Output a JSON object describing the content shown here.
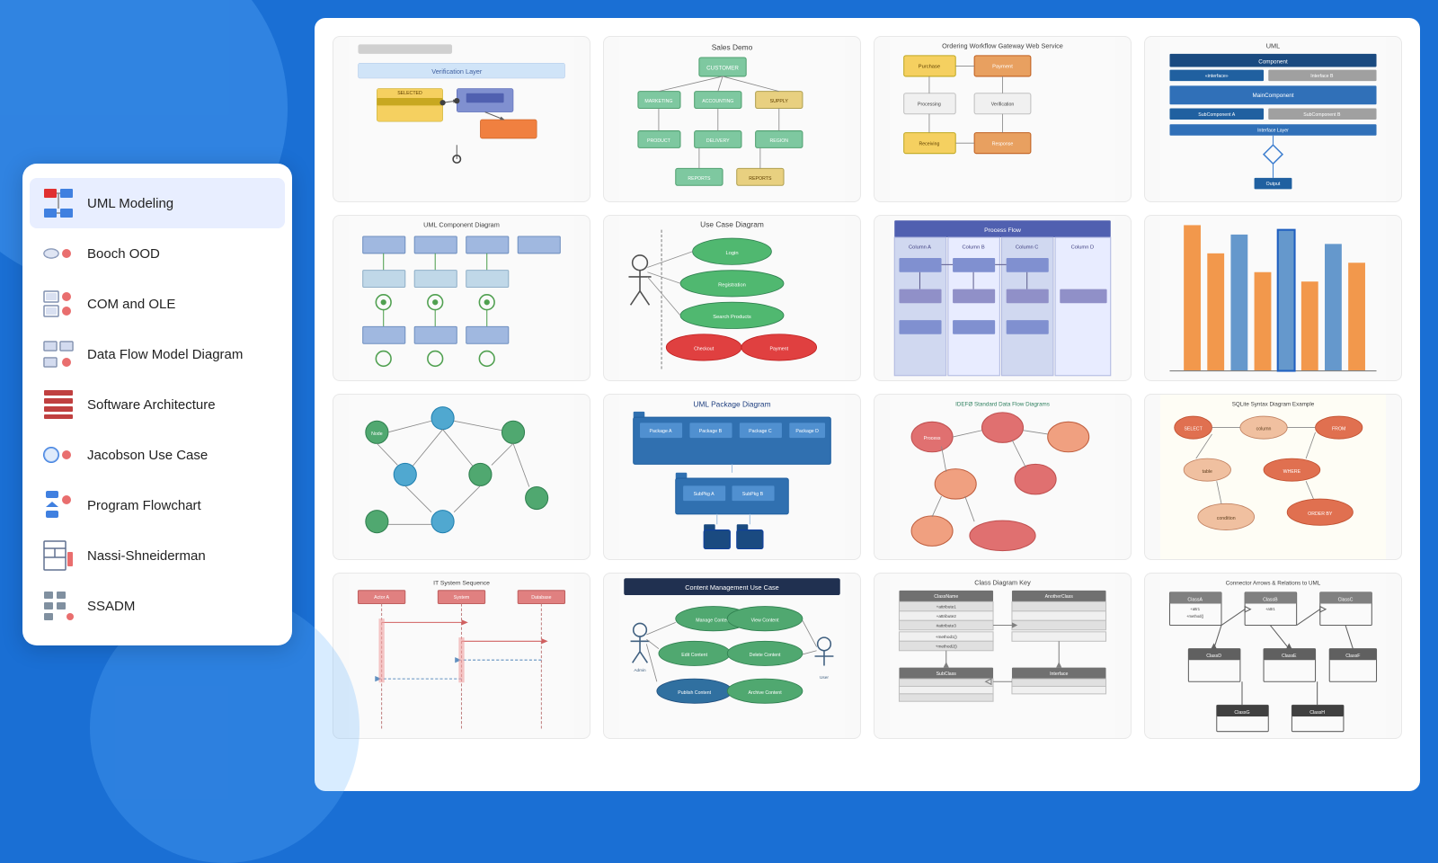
{
  "sidebar": {
    "items": [
      {
        "id": "uml-modeling",
        "label": "UML Modeling",
        "active": true
      },
      {
        "id": "booch-ood",
        "label": "Booch OOD",
        "active": false
      },
      {
        "id": "com-and-ole",
        "label": "COM and OLE",
        "active": false
      },
      {
        "id": "data-flow-model-diagram",
        "label": "Data Flow Model Diagram",
        "active": false
      },
      {
        "id": "software-architecture",
        "label": "Software Architecture",
        "active": false
      },
      {
        "id": "jacobson-use-case",
        "label": "Jacobson Use Case",
        "active": false
      },
      {
        "id": "program-flowchart",
        "label": "Program Flowchart",
        "active": false
      },
      {
        "id": "nassi-shneiderman",
        "label": "Nassi-Shneiderman",
        "active": false
      },
      {
        "id": "ssadm",
        "label": "SSADM",
        "active": false
      }
    ]
  },
  "diagrams": [
    {
      "id": "d1",
      "type": "component-diagram",
      "colors": [
        "#f5c842",
        "#b0c4f0",
        "#f0a060"
      ]
    },
    {
      "id": "d2",
      "type": "dataflow-diagram",
      "colors": [
        "#7ec8a0",
        "#e8d080"
      ]
    },
    {
      "id": "d3",
      "type": "gateway-diagram",
      "colors": [
        "#f5c842",
        "#e8a060",
        "#d4d4d4"
      ]
    },
    {
      "id": "d4",
      "type": "uml-table",
      "colors": [
        "#2060a0",
        "#a0a0a0"
      ]
    },
    {
      "id": "d5",
      "type": "component-diagram2",
      "colors": [
        "#a0b8e0",
        "#80c8a0"
      ]
    },
    {
      "id": "d6",
      "type": "use-case",
      "colors": [
        "#50b870",
        "#e05050"
      ]
    },
    {
      "id": "d7",
      "type": "swimlane",
      "colors": [
        "#8090d0",
        "#c0c8e8"
      ]
    },
    {
      "id": "d8",
      "type": "gantt",
      "colors": [
        "#f08020",
        "#4080c0"
      ]
    },
    {
      "id": "d9",
      "type": "network-diagram",
      "colors": [
        "#60b860",
        "#50a8d0"
      ]
    },
    {
      "id": "d10",
      "type": "package-diagram",
      "colors": [
        "#3070b0",
        "#5090d0"
      ]
    },
    {
      "id": "d11",
      "type": "er-diagram",
      "colors": [
        "#e07070",
        "#f0a080"
      ]
    },
    {
      "id": "d12",
      "type": "sqlite-diagram",
      "colors": [
        "#e07050",
        "#f0c0a0"
      ]
    },
    {
      "id": "d13",
      "type": "sequence-diagram",
      "colors": [
        "#e07070",
        "#f0a0a0"
      ]
    },
    {
      "id": "d14",
      "type": "usecase-management",
      "colors": [
        "#50a870",
        "#3070a0"
      ]
    },
    {
      "id": "d15",
      "type": "class-diagram",
      "colors": [
        "#808080",
        "#a0a0a0"
      ]
    },
    {
      "id": "d16",
      "type": "connector-diagram",
      "colors": [
        "#606060",
        "#888888"
      ]
    }
  ]
}
